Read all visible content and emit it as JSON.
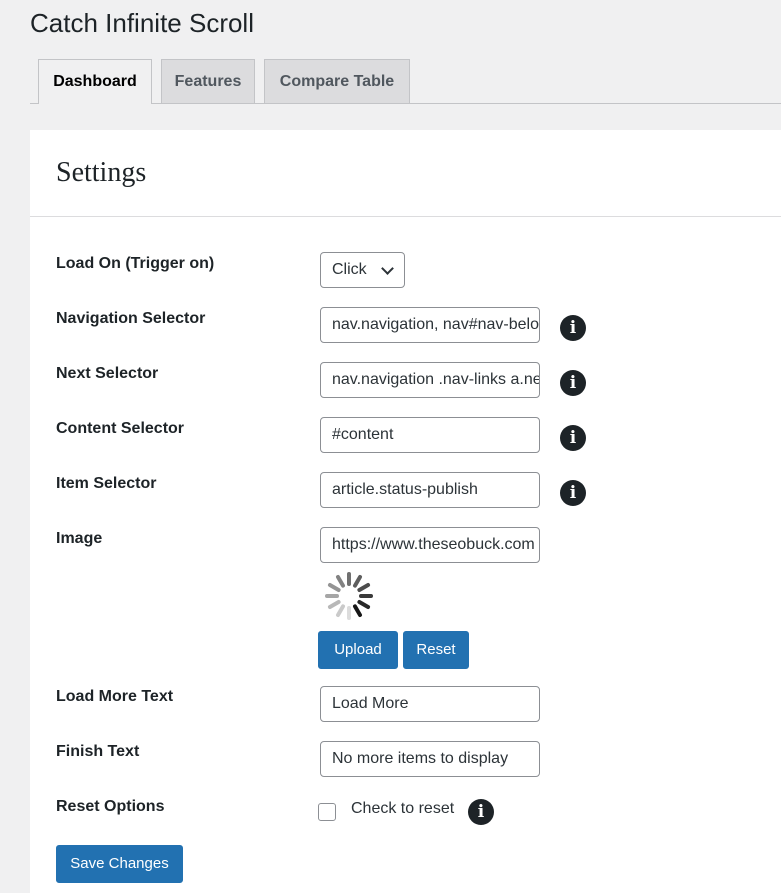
{
  "app": {
    "title": "Catch Infinite Scroll"
  },
  "tabs": [
    {
      "label": "Dashboard",
      "active": true
    },
    {
      "label": "Features"
    },
    {
      "label": "Compare Table"
    }
  ],
  "settings": {
    "title": "Settings",
    "load_on": {
      "label": "Load On (Trigger on)",
      "value": "Click"
    },
    "navigation_selector": {
      "label": "Navigation Selector",
      "value": "nav.navigation, nav#nav-below"
    },
    "next_selector": {
      "label": "Next Selector",
      "value": "nav.navigation .nav-links a.next"
    },
    "content_selector": {
      "label": "Content Selector",
      "value": "#content"
    },
    "item_selector": {
      "label": "Item Selector",
      "value": "article.status-publish"
    },
    "image": {
      "label": "Image",
      "value": "https://www.theseobuck.com",
      "upload_label": "Upload",
      "reset_label": "Reset"
    },
    "load_more_text": {
      "label": "Load More Text",
      "value": "Load More"
    },
    "finish_text": {
      "label": "Finish Text",
      "value": "No more items to display"
    },
    "reset_options": {
      "label": "Reset Options",
      "checkbox_label": "Check to reset",
      "checked": false
    },
    "save_label": "Save Changes"
  },
  "colors": {
    "primary": "#2271b1",
    "background": "#f0f0f1"
  }
}
